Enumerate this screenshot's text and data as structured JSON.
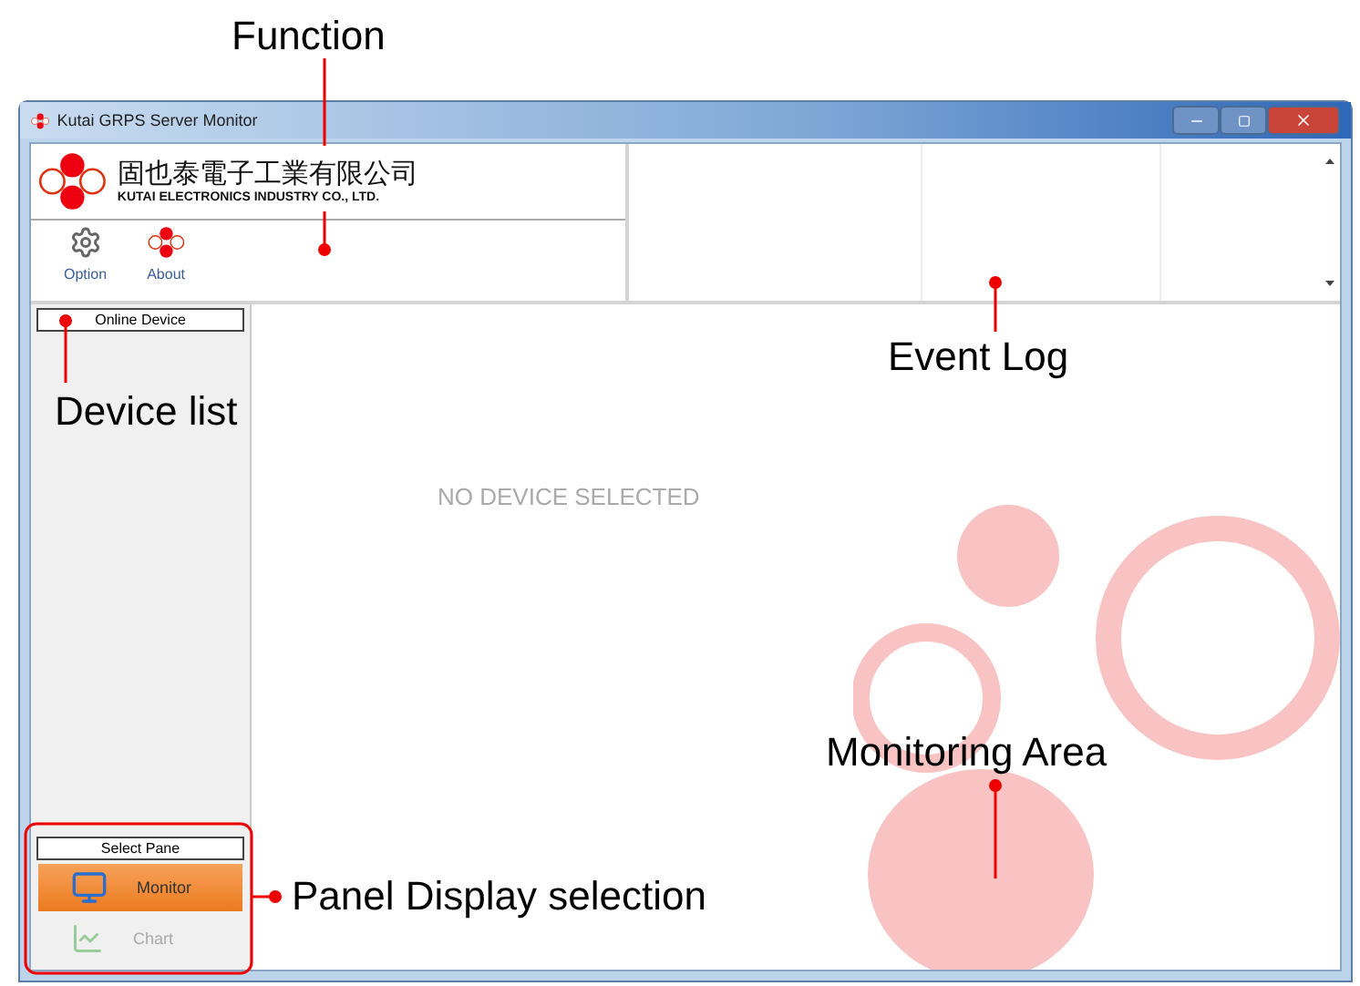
{
  "window": {
    "title": "Kutai GRPS Server Monitor"
  },
  "company": {
    "name_chinese": "固也泰電子工業有限公司",
    "name_english": "KUTAI ELECTRONICS INDUSTRY CO., LTD."
  },
  "toolbar": [
    {
      "kind": "gear",
      "label": "Option"
    },
    {
      "kind": "logo",
      "label": "About"
    }
  ],
  "sidebar": {
    "title": "Online Device"
  },
  "main": {
    "message": "NO DEVICE SELECTED"
  },
  "select_pane": {
    "title": "Select Pane",
    "panes": [
      {
        "kind": "monitor",
        "label": "Monitor",
        "selected": true
      },
      {
        "kind": "chart",
        "label": "Chart",
        "selected": false
      }
    ]
  },
  "annotations": {
    "function": "Function",
    "event_log": "Event Log",
    "device_list": "Device list",
    "monitoring_area": "Monitoring Area",
    "panel_selection": "Panel Display selection"
  }
}
